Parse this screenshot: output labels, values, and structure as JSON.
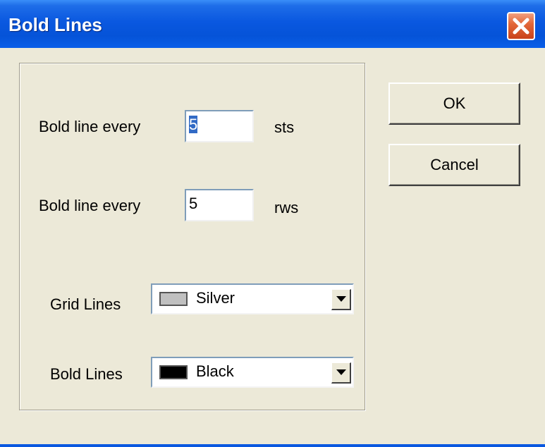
{
  "dialog": {
    "title": "Bold Lines"
  },
  "stitches_row": {
    "label": "Bold line  every",
    "value": "5",
    "unit": "sts"
  },
  "rows_row": {
    "label": "Bold line  every",
    "value": "5",
    "unit": "rws"
  },
  "grid_lines": {
    "label": "Grid Lines",
    "selected": "Silver",
    "swatch_color": "#c0c0c0"
  },
  "bold_lines": {
    "label": "Bold Lines",
    "selected": "Black",
    "swatch_color": "#000000"
  },
  "buttons": {
    "ok": "OK",
    "cancel": "Cancel"
  },
  "icons": {
    "close": "close-icon",
    "dropdown": "chevron-down-icon"
  }
}
